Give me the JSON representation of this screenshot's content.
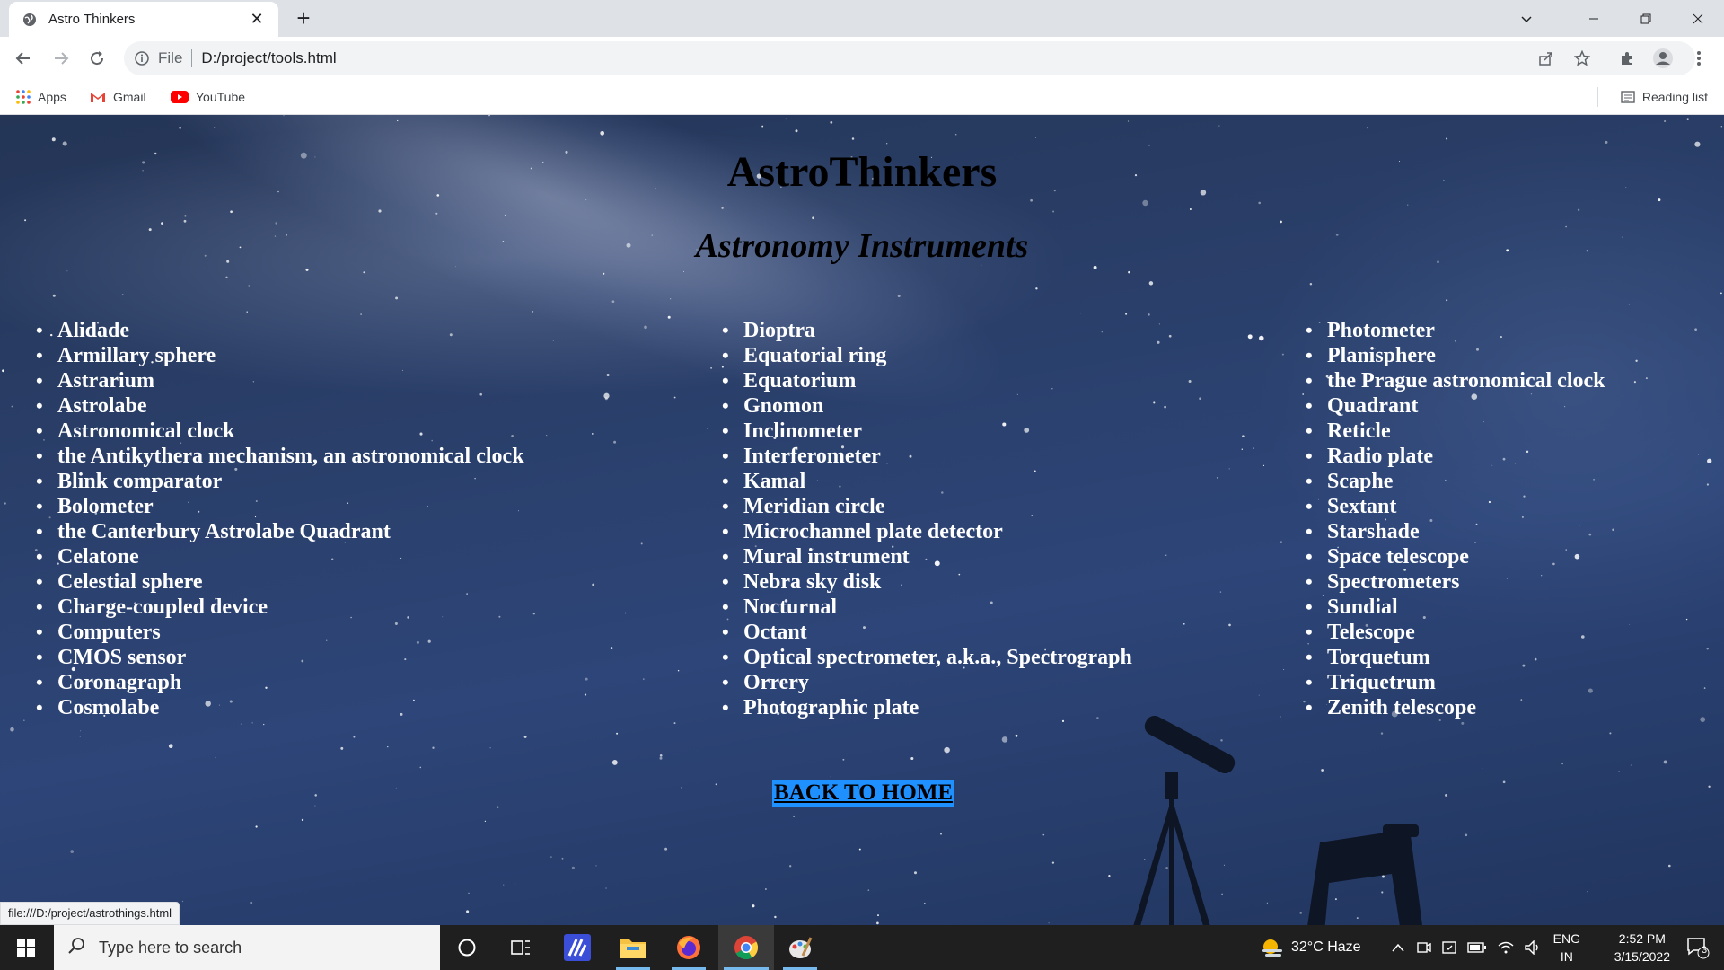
{
  "browser": {
    "tab_title": "Astro Thinkers",
    "omnibox_scheme": "File",
    "omnibox_url": "D:/project/tools.html",
    "bookmarks": [
      {
        "label": "Apps",
        "icon": "apps-grid-icon"
      },
      {
        "label": "Gmail",
        "icon": "gmail-icon"
      },
      {
        "label": "YouTube",
        "icon": "youtube-icon"
      }
    ],
    "reading_list_label": "Reading list",
    "status_url": "file:///D:/project/astrothings.html"
  },
  "page": {
    "title": "AstroThinkers",
    "subtitle": "Astronomy Instruments",
    "columns": [
      [
        "Alidade",
        "Armillary sphere",
        "Astrarium",
        "Astrolabe",
        "Astronomical clock",
        "the Antikythera mechanism, an astronomical clock",
        "Blink comparator",
        "Bolometer",
        "the Canterbury Astrolabe Quadrant",
        "Celatone",
        "Celestial sphere",
        "Charge-coupled device",
        "Computers",
        "CMOS sensor",
        "Coronagraph",
        "Cosmolabe"
      ],
      [
        "Dioptra",
        "Equatorial ring",
        "Equatorium",
        "Gnomon",
        "Inclinometer",
        "Interferometer",
        "Kamal",
        "Meridian circle",
        "Microchannel plate detector",
        "Mural instrument",
        "Nebra sky disk",
        "Nocturnal",
        "Octant",
        "Optical spectrometer, a.k.a., Spectrograph",
        "Orrery",
        "Photographic plate"
      ],
      [
        "Photometer",
        "Planisphere",
        "the Prague astronomical clock",
        "Quadrant",
        "Reticle",
        "Radio plate",
        "Scaphe",
        "Sextant",
        "Starshade",
        "Space telescope",
        "Spectrometers",
        "Sundial",
        "Telescope",
        "Torquetum",
        "Triquetrum",
        "Zenith telescope"
      ]
    ],
    "back_link": "BACK TO HOME"
  },
  "taskbar": {
    "search_placeholder": "Type here to search",
    "weather": "32°C  Haze",
    "language_top": "ENG",
    "language_bottom": "IN",
    "time": "2:52 PM",
    "date": "3/15/2022",
    "notification_count": "3"
  }
}
